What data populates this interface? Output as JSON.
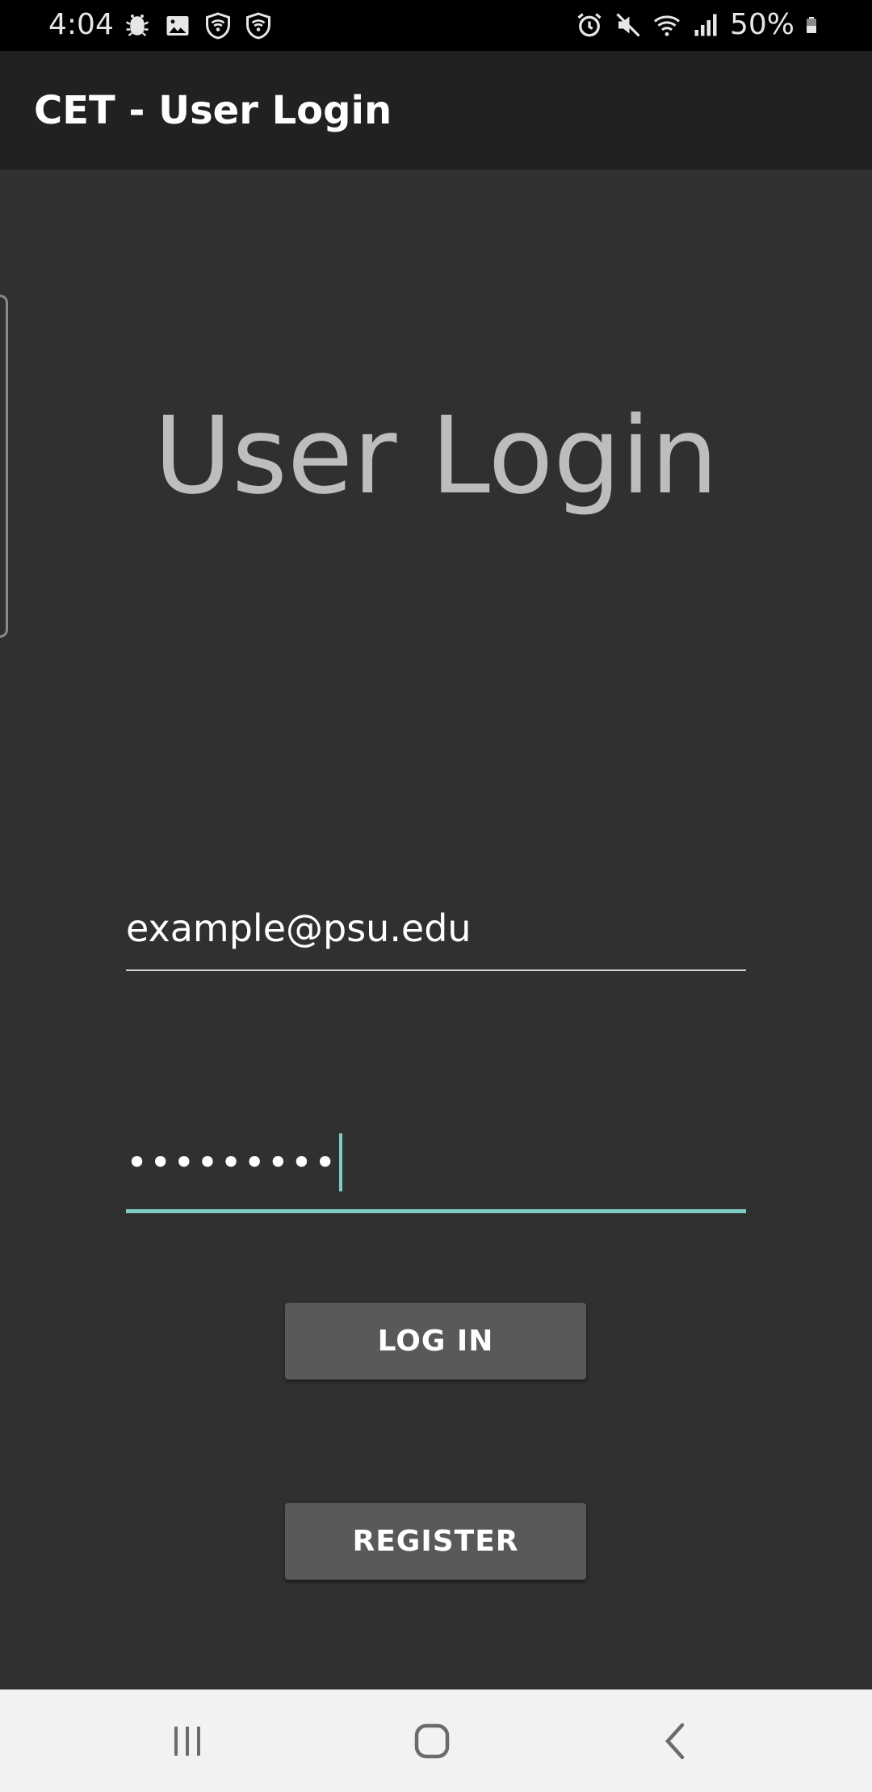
{
  "status_bar": {
    "time": "4:04",
    "battery": "50%",
    "left_icons": [
      "bug-icon",
      "image-icon",
      "shield-wifi-icon",
      "shield-wifi-icon"
    ],
    "right_icons": [
      "alarm-icon",
      "mute-icon",
      "wifi-icon",
      "signal-icon",
      "battery-icon"
    ]
  },
  "app_bar": {
    "title": "CET - User Login"
  },
  "login": {
    "heading": "User Login",
    "email_value": "example@psu.edu",
    "password_value": "•••••••••",
    "login_label": "LOG IN",
    "register_label": "REGISTER"
  },
  "colors": {
    "accent": "#80cbc4",
    "background": "#303030",
    "app_bar": "#212121",
    "button": "#595959"
  }
}
